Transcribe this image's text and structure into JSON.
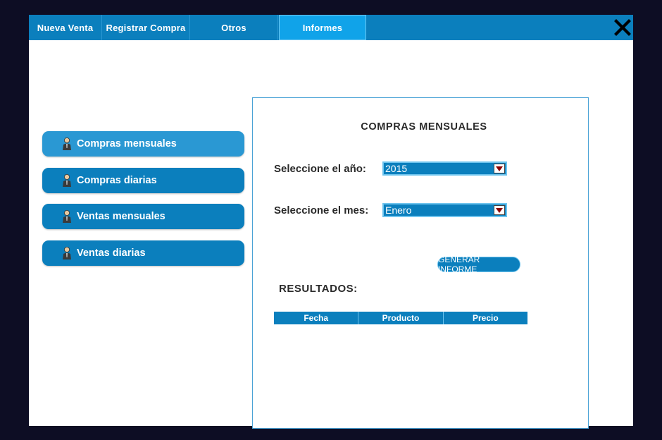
{
  "menu": {
    "tabs": [
      {
        "label": "Nueva Venta"
      },
      {
        "label": "Registrar Compra"
      },
      {
        "label": "Otros"
      },
      {
        "label": "Informes"
      }
    ],
    "close_icon": "close-icon"
  },
  "sidebar": {
    "items": [
      {
        "label": "Compras mensuales",
        "icon": "person-icon"
      },
      {
        "label": "Compras diarias",
        "icon": "person-icon"
      },
      {
        "label": "Ventas mensuales",
        "icon": "person-icon"
      },
      {
        "label": "Ventas diarias",
        "icon": "person-icon"
      }
    ]
  },
  "panel": {
    "title": "COMPRAS MENSUALES",
    "year_label": "Seleccione el año:",
    "year_value": "2015",
    "month_label": "Seleccione el mes:",
    "month_value": "Enero",
    "generate_label": "GENERAR INFORME",
    "results_label": "RESULTADOS:",
    "table": {
      "columns": [
        "Fecha",
        "Producto",
        "Precio"
      ]
    }
  },
  "colors": {
    "accent": "#0b7fbd",
    "active_tab": "#10a3e9",
    "background": "#0d0d24"
  }
}
